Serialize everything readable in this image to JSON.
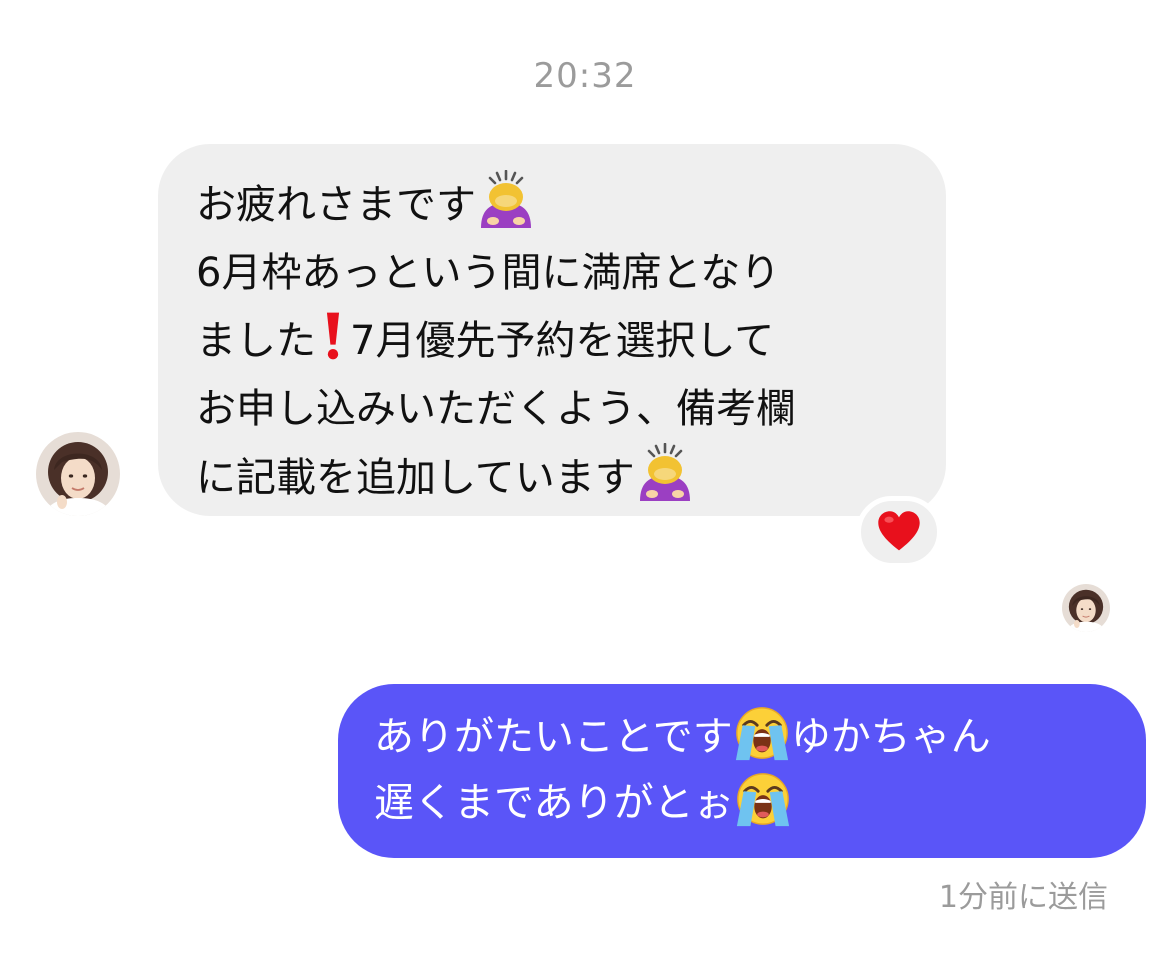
{
  "thread": {
    "timestamp": "20:32",
    "status": "1分前に送信"
  },
  "incoming": {
    "lines": [
      "お疲れさまです",
      "6月枠あっという間に満席となり",
      "ました",
      "7月優先予約を選択して",
      "お申し込みいただくよう、備考欄",
      "に記載を追加しています"
    ],
    "reaction": "heart-emoji",
    "emojis": [
      "person-bowing-emoji",
      "red-exclamation-emoji",
      "person-bowing-emoji"
    ]
  },
  "outgoing": {
    "lines": [
      "ありがたいことです",
      "ゆかちゃん",
      "遅くまでありがとぉ"
    ],
    "emojis": [
      "loudly-crying-face-emoji",
      "loudly-crying-face-emoji"
    ],
    "color": "#5a55f8"
  },
  "colors": {
    "incoming_bubble": "#efefef",
    "meta_text": "#9b9b9b",
    "heart": "#e8101c"
  }
}
